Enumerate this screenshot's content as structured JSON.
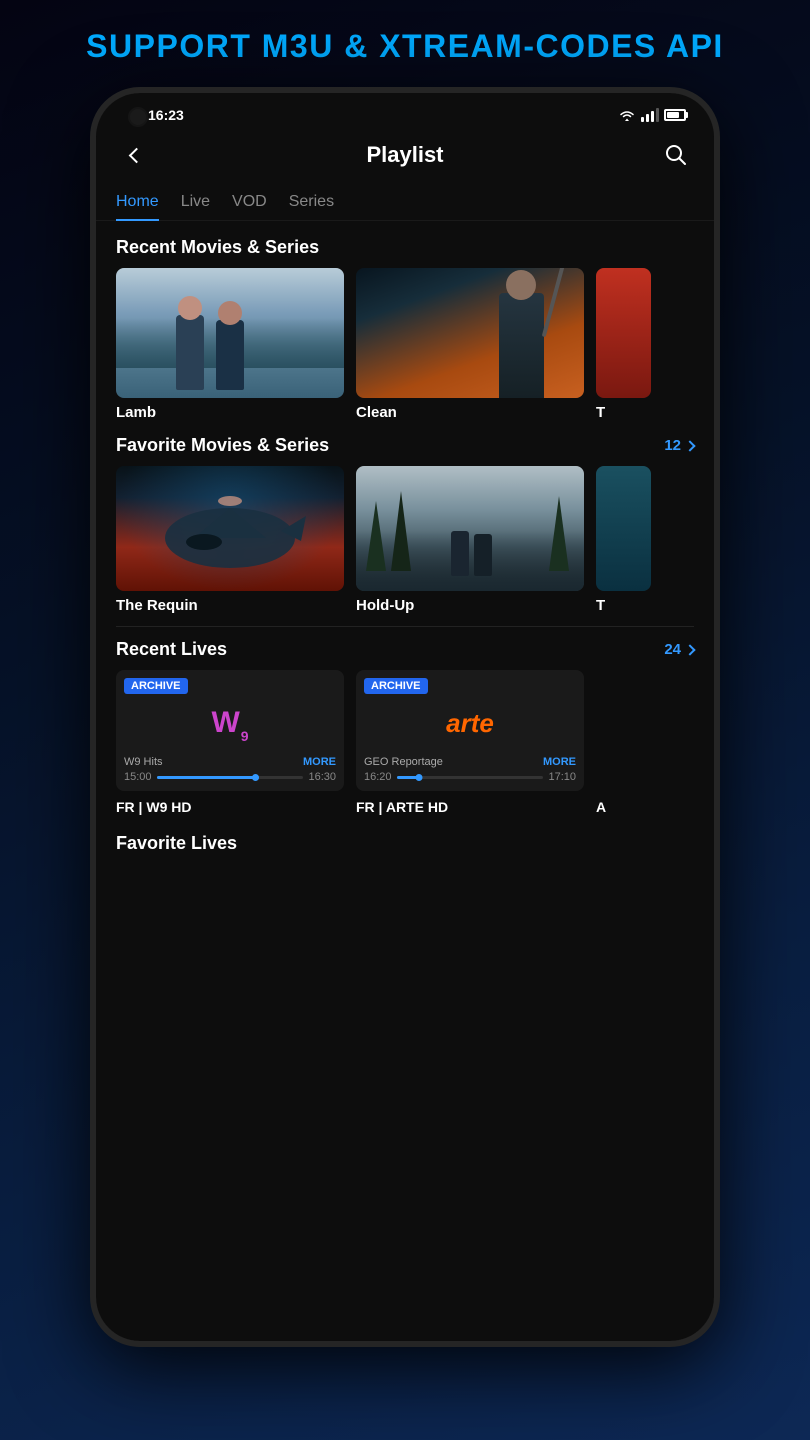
{
  "header": {
    "title": "SUPPORT M3U & XTREAM-CODES API"
  },
  "status_bar": {
    "time": "16:23",
    "wifi": true,
    "battery": 75
  },
  "nav": {
    "back_label": "back",
    "title": "Playlist",
    "search_label": "search"
  },
  "tabs": [
    {
      "label": "Home",
      "active": true
    },
    {
      "label": "Live",
      "active": false
    },
    {
      "label": "VOD",
      "active": false
    },
    {
      "label": "Series",
      "active": false
    }
  ],
  "sections": {
    "recent_movies": {
      "title": "Recent Movies & Series",
      "movies": [
        {
          "title": "Lamb"
        },
        {
          "title": "Clean"
        },
        {
          "title": "T"
        }
      ]
    },
    "favorite_movies": {
      "title": "Favorite Movies & Series",
      "count": "12",
      "movies": [
        {
          "title": "The Requin"
        },
        {
          "title": "Hold-Up"
        },
        {
          "title": "T"
        }
      ]
    },
    "recent_lives": {
      "title": "Recent Lives",
      "count": "24",
      "channels": [
        {
          "badge": "ARCHIVE",
          "logo_type": "w9",
          "logo_text": "W9",
          "program": "W9 Hits",
          "more": "MORE",
          "time_start": "15:00",
          "time_end": "16:30",
          "progress": 70,
          "channel_name": "FR | W9 HD"
        },
        {
          "badge": "ARCHIVE",
          "logo_type": "arte",
          "logo_text": "arte",
          "program": "GEO Reportage",
          "more": "MORE",
          "time_start": "16:20",
          "time_end": "17:10",
          "progress": 15,
          "channel_name": "FR | ARTE HD"
        }
      ]
    },
    "favorite_lives": {
      "title": "Favorite Lives"
    }
  }
}
